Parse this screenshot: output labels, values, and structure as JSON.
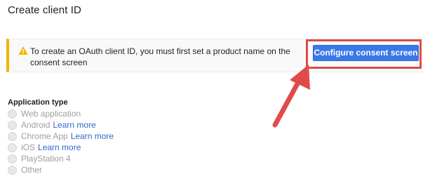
{
  "page": {
    "title": "Create client ID"
  },
  "warning": {
    "text": "To create an OAuth client ID, you must first set a product name on the consent screen",
    "icon": "warning-icon",
    "accent_color": "#f4b400"
  },
  "actions": {
    "configure_label": "Configure consent screen",
    "button_color": "#3b78e7"
  },
  "annotation": {
    "highlight_color": "#e04a4a"
  },
  "application_type": {
    "label": "Application type",
    "options": [
      {
        "label": "Web application",
        "link": ""
      },
      {
        "label": "Android",
        "link": "Learn more"
      },
      {
        "label": "Chrome App",
        "link": "Learn more"
      },
      {
        "label": "iOS",
        "link": "Learn more"
      },
      {
        "label": "PlayStation 4",
        "link": ""
      },
      {
        "label": "Other",
        "link": ""
      }
    ]
  }
}
